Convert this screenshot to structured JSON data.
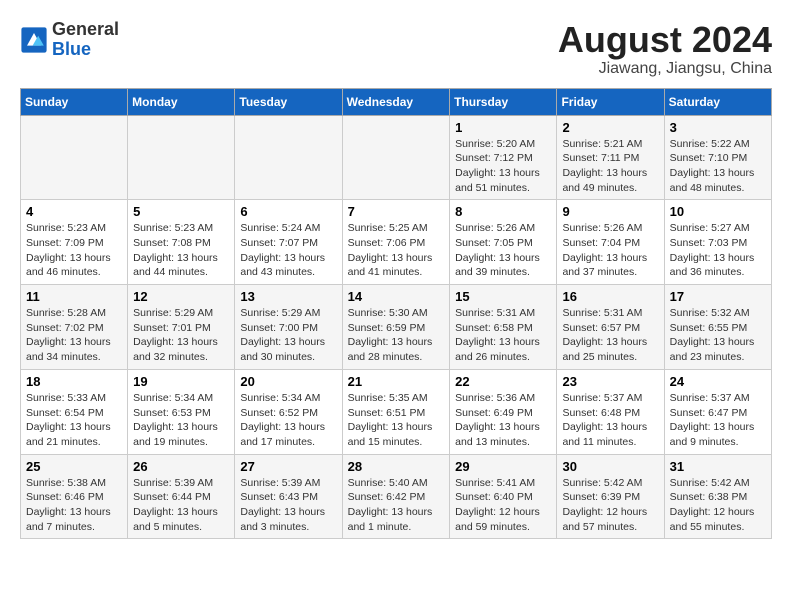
{
  "header": {
    "logo_general": "General",
    "logo_blue": "Blue",
    "month_year": "August 2024",
    "location": "Jiawang, Jiangsu, China"
  },
  "weekdays": [
    "Sunday",
    "Monday",
    "Tuesday",
    "Wednesday",
    "Thursday",
    "Friday",
    "Saturday"
  ],
  "weeks": [
    [
      {
        "day": "",
        "info": ""
      },
      {
        "day": "",
        "info": ""
      },
      {
        "day": "",
        "info": ""
      },
      {
        "day": "",
        "info": ""
      },
      {
        "day": "1",
        "info": "Sunrise: 5:20 AM\nSunset: 7:12 PM\nDaylight: 13 hours\nand 51 minutes."
      },
      {
        "day": "2",
        "info": "Sunrise: 5:21 AM\nSunset: 7:11 PM\nDaylight: 13 hours\nand 49 minutes."
      },
      {
        "day": "3",
        "info": "Sunrise: 5:22 AM\nSunset: 7:10 PM\nDaylight: 13 hours\nand 48 minutes."
      }
    ],
    [
      {
        "day": "4",
        "info": "Sunrise: 5:23 AM\nSunset: 7:09 PM\nDaylight: 13 hours\nand 46 minutes."
      },
      {
        "day": "5",
        "info": "Sunrise: 5:23 AM\nSunset: 7:08 PM\nDaylight: 13 hours\nand 44 minutes."
      },
      {
        "day": "6",
        "info": "Sunrise: 5:24 AM\nSunset: 7:07 PM\nDaylight: 13 hours\nand 43 minutes."
      },
      {
        "day": "7",
        "info": "Sunrise: 5:25 AM\nSunset: 7:06 PM\nDaylight: 13 hours\nand 41 minutes."
      },
      {
        "day": "8",
        "info": "Sunrise: 5:26 AM\nSunset: 7:05 PM\nDaylight: 13 hours\nand 39 minutes."
      },
      {
        "day": "9",
        "info": "Sunrise: 5:26 AM\nSunset: 7:04 PM\nDaylight: 13 hours\nand 37 minutes."
      },
      {
        "day": "10",
        "info": "Sunrise: 5:27 AM\nSunset: 7:03 PM\nDaylight: 13 hours\nand 36 minutes."
      }
    ],
    [
      {
        "day": "11",
        "info": "Sunrise: 5:28 AM\nSunset: 7:02 PM\nDaylight: 13 hours\nand 34 minutes."
      },
      {
        "day": "12",
        "info": "Sunrise: 5:29 AM\nSunset: 7:01 PM\nDaylight: 13 hours\nand 32 minutes."
      },
      {
        "day": "13",
        "info": "Sunrise: 5:29 AM\nSunset: 7:00 PM\nDaylight: 13 hours\nand 30 minutes."
      },
      {
        "day": "14",
        "info": "Sunrise: 5:30 AM\nSunset: 6:59 PM\nDaylight: 13 hours\nand 28 minutes."
      },
      {
        "day": "15",
        "info": "Sunrise: 5:31 AM\nSunset: 6:58 PM\nDaylight: 13 hours\nand 26 minutes."
      },
      {
        "day": "16",
        "info": "Sunrise: 5:31 AM\nSunset: 6:57 PM\nDaylight: 13 hours\nand 25 minutes."
      },
      {
        "day": "17",
        "info": "Sunrise: 5:32 AM\nSunset: 6:55 PM\nDaylight: 13 hours\nand 23 minutes."
      }
    ],
    [
      {
        "day": "18",
        "info": "Sunrise: 5:33 AM\nSunset: 6:54 PM\nDaylight: 13 hours\nand 21 minutes."
      },
      {
        "day": "19",
        "info": "Sunrise: 5:34 AM\nSunset: 6:53 PM\nDaylight: 13 hours\nand 19 minutes."
      },
      {
        "day": "20",
        "info": "Sunrise: 5:34 AM\nSunset: 6:52 PM\nDaylight: 13 hours\nand 17 minutes."
      },
      {
        "day": "21",
        "info": "Sunrise: 5:35 AM\nSunset: 6:51 PM\nDaylight: 13 hours\nand 15 minutes."
      },
      {
        "day": "22",
        "info": "Sunrise: 5:36 AM\nSunset: 6:49 PM\nDaylight: 13 hours\nand 13 minutes."
      },
      {
        "day": "23",
        "info": "Sunrise: 5:37 AM\nSunset: 6:48 PM\nDaylight: 13 hours\nand 11 minutes."
      },
      {
        "day": "24",
        "info": "Sunrise: 5:37 AM\nSunset: 6:47 PM\nDaylight: 13 hours\nand 9 minutes."
      }
    ],
    [
      {
        "day": "25",
        "info": "Sunrise: 5:38 AM\nSunset: 6:46 PM\nDaylight: 13 hours\nand 7 minutes."
      },
      {
        "day": "26",
        "info": "Sunrise: 5:39 AM\nSunset: 6:44 PM\nDaylight: 13 hours\nand 5 minutes."
      },
      {
        "day": "27",
        "info": "Sunrise: 5:39 AM\nSunset: 6:43 PM\nDaylight: 13 hours\nand 3 minutes."
      },
      {
        "day": "28",
        "info": "Sunrise: 5:40 AM\nSunset: 6:42 PM\nDaylight: 13 hours\nand 1 minute."
      },
      {
        "day": "29",
        "info": "Sunrise: 5:41 AM\nSunset: 6:40 PM\nDaylight: 12 hours\nand 59 minutes."
      },
      {
        "day": "30",
        "info": "Sunrise: 5:42 AM\nSunset: 6:39 PM\nDaylight: 12 hours\nand 57 minutes."
      },
      {
        "day": "31",
        "info": "Sunrise: 5:42 AM\nSunset: 6:38 PM\nDaylight: 12 hours\nand 55 minutes."
      }
    ]
  ]
}
